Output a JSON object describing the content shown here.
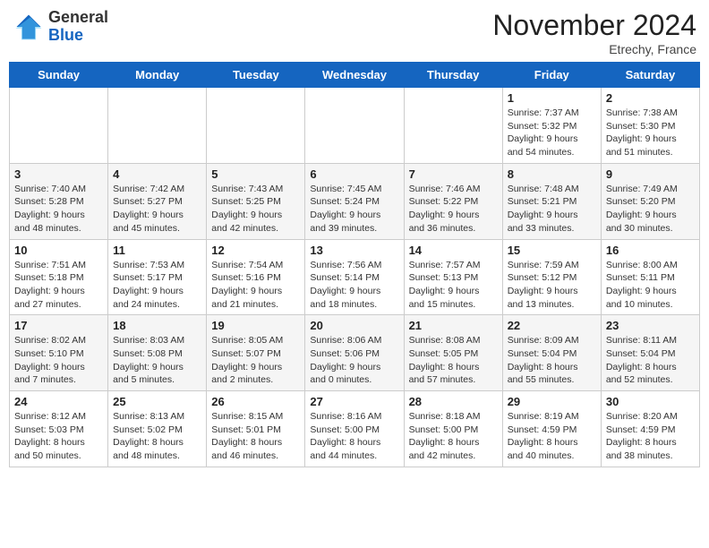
{
  "header": {
    "logo_line1": "General",
    "logo_line2": "Blue",
    "month_title": "November 2024",
    "location": "Etrechy, France"
  },
  "weekdays": [
    "Sunday",
    "Monday",
    "Tuesday",
    "Wednesday",
    "Thursday",
    "Friday",
    "Saturday"
  ],
  "weeks": [
    [
      {
        "day": "",
        "detail": ""
      },
      {
        "day": "",
        "detail": ""
      },
      {
        "day": "",
        "detail": ""
      },
      {
        "day": "",
        "detail": ""
      },
      {
        "day": "",
        "detail": ""
      },
      {
        "day": "1",
        "detail": "Sunrise: 7:37 AM\nSunset: 5:32 PM\nDaylight: 9 hours\nand 54 minutes."
      },
      {
        "day": "2",
        "detail": "Sunrise: 7:38 AM\nSunset: 5:30 PM\nDaylight: 9 hours\nand 51 minutes."
      }
    ],
    [
      {
        "day": "3",
        "detail": "Sunrise: 7:40 AM\nSunset: 5:28 PM\nDaylight: 9 hours\nand 48 minutes."
      },
      {
        "day": "4",
        "detail": "Sunrise: 7:42 AM\nSunset: 5:27 PM\nDaylight: 9 hours\nand 45 minutes."
      },
      {
        "day": "5",
        "detail": "Sunrise: 7:43 AM\nSunset: 5:25 PM\nDaylight: 9 hours\nand 42 minutes."
      },
      {
        "day": "6",
        "detail": "Sunrise: 7:45 AM\nSunset: 5:24 PM\nDaylight: 9 hours\nand 39 minutes."
      },
      {
        "day": "7",
        "detail": "Sunrise: 7:46 AM\nSunset: 5:22 PM\nDaylight: 9 hours\nand 36 minutes."
      },
      {
        "day": "8",
        "detail": "Sunrise: 7:48 AM\nSunset: 5:21 PM\nDaylight: 9 hours\nand 33 minutes."
      },
      {
        "day": "9",
        "detail": "Sunrise: 7:49 AM\nSunset: 5:20 PM\nDaylight: 9 hours\nand 30 minutes."
      }
    ],
    [
      {
        "day": "10",
        "detail": "Sunrise: 7:51 AM\nSunset: 5:18 PM\nDaylight: 9 hours\nand 27 minutes."
      },
      {
        "day": "11",
        "detail": "Sunrise: 7:53 AM\nSunset: 5:17 PM\nDaylight: 9 hours\nand 24 minutes."
      },
      {
        "day": "12",
        "detail": "Sunrise: 7:54 AM\nSunset: 5:16 PM\nDaylight: 9 hours\nand 21 minutes."
      },
      {
        "day": "13",
        "detail": "Sunrise: 7:56 AM\nSunset: 5:14 PM\nDaylight: 9 hours\nand 18 minutes."
      },
      {
        "day": "14",
        "detail": "Sunrise: 7:57 AM\nSunset: 5:13 PM\nDaylight: 9 hours\nand 15 minutes."
      },
      {
        "day": "15",
        "detail": "Sunrise: 7:59 AM\nSunset: 5:12 PM\nDaylight: 9 hours\nand 13 minutes."
      },
      {
        "day": "16",
        "detail": "Sunrise: 8:00 AM\nSunset: 5:11 PM\nDaylight: 9 hours\nand 10 minutes."
      }
    ],
    [
      {
        "day": "17",
        "detail": "Sunrise: 8:02 AM\nSunset: 5:10 PM\nDaylight: 9 hours\nand 7 minutes."
      },
      {
        "day": "18",
        "detail": "Sunrise: 8:03 AM\nSunset: 5:08 PM\nDaylight: 9 hours\nand 5 minutes."
      },
      {
        "day": "19",
        "detail": "Sunrise: 8:05 AM\nSunset: 5:07 PM\nDaylight: 9 hours\nand 2 minutes."
      },
      {
        "day": "20",
        "detail": "Sunrise: 8:06 AM\nSunset: 5:06 PM\nDaylight: 9 hours\nand 0 minutes."
      },
      {
        "day": "21",
        "detail": "Sunrise: 8:08 AM\nSunset: 5:05 PM\nDaylight: 8 hours\nand 57 minutes."
      },
      {
        "day": "22",
        "detail": "Sunrise: 8:09 AM\nSunset: 5:04 PM\nDaylight: 8 hours\nand 55 minutes."
      },
      {
        "day": "23",
        "detail": "Sunrise: 8:11 AM\nSunset: 5:04 PM\nDaylight: 8 hours\nand 52 minutes."
      }
    ],
    [
      {
        "day": "24",
        "detail": "Sunrise: 8:12 AM\nSunset: 5:03 PM\nDaylight: 8 hours\nand 50 minutes."
      },
      {
        "day": "25",
        "detail": "Sunrise: 8:13 AM\nSunset: 5:02 PM\nDaylight: 8 hours\nand 48 minutes."
      },
      {
        "day": "26",
        "detail": "Sunrise: 8:15 AM\nSunset: 5:01 PM\nDaylight: 8 hours\nand 46 minutes."
      },
      {
        "day": "27",
        "detail": "Sunrise: 8:16 AM\nSunset: 5:00 PM\nDaylight: 8 hours\nand 44 minutes."
      },
      {
        "day": "28",
        "detail": "Sunrise: 8:18 AM\nSunset: 5:00 PM\nDaylight: 8 hours\nand 42 minutes."
      },
      {
        "day": "29",
        "detail": "Sunrise: 8:19 AM\nSunset: 4:59 PM\nDaylight: 8 hours\nand 40 minutes."
      },
      {
        "day": "30",
        "detail": "Sunrise: 8:20 AM\nSunset: 4:59 PM\nDaylight: 8 hours\nand 38 minutes."
      }
    ]
  ]
}
